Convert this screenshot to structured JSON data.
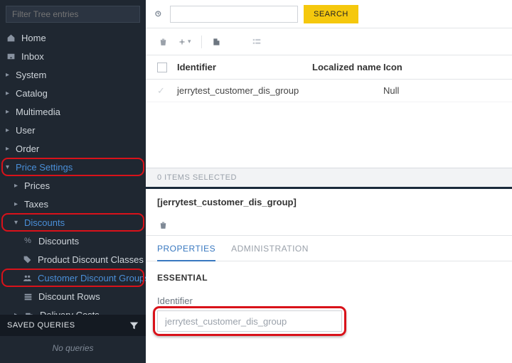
{
  "sidebar": {
    "filter_placeholder": "Filter Tree entries",
    "items": [
      {
        "label": "Home",
        "icon": "home"
      },
      {
        "label": "Inbox",
        "icon": "inbox"
      },
      {
        "label": "System",
        "chev": true
      },
      {
        "label": "Catalog",
        "chev": true
      },
      {
        "label": "Multimedia",
        "chev": true
      },
      {
        "label": "User",
        "chev": true
      },
      {
        "label": "Order",
        "chev": true
      },
      {
        "label": "Price Settings",
        "chev": true,
        "hl": true,
        "blue": true,
        "expanded": true
      },
      {
        "label": "Prices",
        "indent": 1,
        "chev": true
      },
      {
        "label": "Taxes",
        "indent": 1,
        "chev": true
      },
      {
        "label": "Discounts",
        "indent": 1,
        "chev": true,
        "hl": true,
        "blue": true,
        "expanded": true
      },
      {
        "label": "Discounts",
        "indent": 2,
        "icon": "pct"
      },
      {
        "label": "Product Discount Classes",
        "indent": 2,
        "icon": "tag"
      },
      {
        "label": "Customer Discount Groups",
        "indent": 2,
        "hl": true,
        "blue": true,
        "icon": "grp"
      },
      {
        "label": "Discount Rows",
        "indent": 2,
        "icon": "rows"
      },
      {
        "label": "Delivery Costs",
        "indent": 1,
        "icon": "truck",
        "chev": true
      }
    ],
    "saved_queries_label": "SAVED QUERIES",
    "no_queries": "No queries"
  },
  "search": {
    "button": "SEARCH",
    "value": ""
  },
  "table": {
    "headers": {
      "identifier": "Identifier",
      "localized": "Localized name",
      "icon": "Icon"
    },
    "rows": [
      {
        "identifier": "jerrytest_customer_dis_group",
        "localized": "",
        "icon": "Null"
      }
    ],
    "selected_count": "0 ITEMS SELECTED"
  },
  "detail": {
    "title": "[jerrytest_customer_dis_group]",
    "tabs": {
      "properties": "PROPERTIES",
      "administration": "ADMINISTRATION"
    },
    "section": "ESSENTIAL",
    "identifier_label": "Identifier",
    "identifier_value": "jerrytest_customer_dis_group"
  }
}
